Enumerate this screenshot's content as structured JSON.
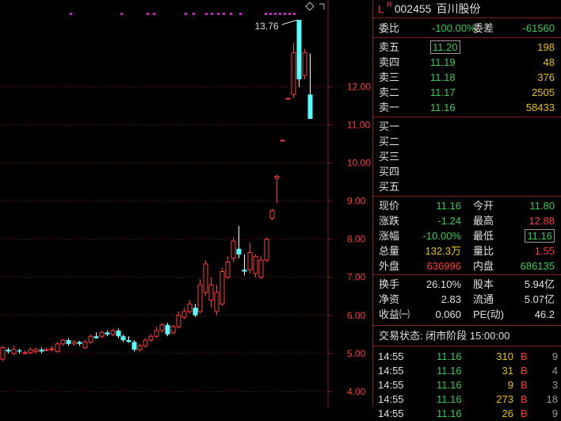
{
  "stock": {
    "flag_l": "L",
    "flag_r": "R",
    "code": "002455",
    "name": "百川股份"
  },
  "chart_data": {
    "type": "candlestick",
    "y_ticks": [
      "12.00",
      "11.00",
      "10.00",
      "9.00",
      "8.00",
      "7.00",
      "6.00",
      "5.00",
      "4.00"
    ],
    "high_annotation": "13.76",
    "ylim": [
      3.6,
      14.2
    ],
    "candles": [
      {
        "o": 4.85,
        "c": 5.15,
        "h": 5.2,
        "l": 4.8
      },
      {
        "o": 5.1,
        "c": 5.05,
        "h": 5.15,
        "l": 5.0
      },
      {
        "o": 5.0,
        "c": 5.1,
        "h": 5.2,
        "l": 4.95
      },
      {
        "o": 5.08,
        "c": 5.05,
        "h": 5.12,
        "l": 5.0
      },
      {
        "o": 5.0,
        "c": 5.02,
        "h": 5.08,
        "l": 4.98
      },
      {
        "o": 5.02,
        "c": 5.1,
        "h": 5.15,
        "l": 4.98
      },
      {
        "o": 5.05,
        "c": 5.1,
        "h": 5.15,
        "l": 5.0
      },
      {
        "o": 5.1,
        "c": 5.05,
        "h": 5.15,
        "l": 5.0
      },
      {
        "o": 5.08,
        "c": 5.1,
        "h": 5.15,
        "l": 5.05
      },
      {
        "o": 5.1,
        "c": 5.12,
        "h": 5.2,
        "l": 5.05
      },
      {
        "o": 5.05,
        "c": 5.25,
        "h": 5.3,
        "l": 5.02
      },
      {
        "o": 5.25,
        "c": 5.35,
        "h": 5.38,
        "l": 5.2
      },
      {
        "o": 5.35,
        "c": 5.25,
        "h": 5.4,
        "l": 5.2
      },
      {
        "o": 5.25,
        "c": 5.3,
        "h": 5.35,
        "l": 5.2
      },
      {
        "o": 5.3,
        "c": 5.25,
        "h": 5.33,
        "l": 5.2
      },
      {
        "o": 5.15,
        "c": 5.3,
        "h": 5.35,
        "l": 5.12
      },
      {
        "o": 5.3,
        "c": 5.45,
        "h": 5.5,
        "l": 5.25
      },
      {
        "o": 5.45,
        "c": 5.4,
        "h": 5.55,
        "l": 5.38
      },
      {
        "o": 5.45,
        "c": 5.55,
        "h": 5.6,
        "l": 5.4
      },
      {
        "o": 5.55,
        "c": 5.5,
        "h": 5.6,
        "l": 5.45
      },
      {
        "o": 5.5,
        "c": 5.6,
        "h": 5.65,
        "l": 5.45
      },
      {
        "o": 5.6,
        "c": 5.45,
        "h": 5.65,
        "l": 5.4
      },
      {
        "o": 5.45,
        "c": 5.35,
        "h": 5.5,
        "l": 5.3
      },
      {
        "o": 5.35,
        "c": 5.3,
        "h": 5.45,
        "l": 5.28
      },
      {
        "o": 5.3,
        "c": 5.1,
        "h": 5.35,
        "l": 5.05
      },
      {
        "o": 5.1,
        "c": 5.2,
        "h": 5.25,
        "l": 5.05
      },
      {
        "o": 5.2,
        "c": 5.35,
        "h": 5.4,
        "l": 5.15
      },
      {
        "o": 5.35,
        "c": 5.45,
        "h": 5.5,
        "l": 5.3
      },
      {
        "o": 5.45,
        "c": 5.6,
        "h": 5.7,
        "l": 5.4
      },
      {
        "o": 5.6,
        "c": 5.75,
        "h": 5.8,
        "l": 5.55
      },
      {
        "o": 5.75,
        "c": 5.5,
        "h": 5.8,
        "l": 5.45
      },
      {
        "o": 5.55,
        "c": 5.7,
        "h": 5.75,
        "l": 5.5
      },
      {
        "o": 5.7,
        "c": 6.0,
        "h": 6.1,
        "l": 5.65
      },
      {
        "o": 5.95,
        "c": 6.1,
        "h": 6.2,
        "l": 5.9
      },
      {
        "o": 6.1,
        "c": 6.3,
        "h": 6.4,
        "l": 6.05
      },
      {
        "o": 6.2,
        "c": 6.0,
        "h": 6.3,
        "l": 5.95
      },
      {
        "o": 6.1,
        "c": 6.8,
        "h": 6.95,
        "l": 6.05
      },
      {
        "o": 6.6,
        "c": 7.35,
        "h": 7.45,
        "l": 6.5
      },
      {
        "o": 6.4,
        "c": 6.8,
        "h": 7.0,
        "l": 6.2
      },
      {
        "o": 6.1,
        "c": 6.6,
        "h": 6.8,
        "l": 6.0
      },
      {
        "o": 6.3,
        "c": 7.15,
        "h": 7.25,
        "l": 6.25
      },
      {
        "o": 7.0,
        "c": 7.4,
        "h": 7.55,
        "l": 6.95
      },
      {
        "o": 7.5,
        "c": 7.95,
        "h": 8.05,
        "l": 7.4
      },
      {
        "o": 7.75,
        "c": 7.6,
        "h": 8.35,
        "l": 7.5
      },
      {
        "o": 7.2,
        "c": 7.15,
        "h": 7.6,
        "l": 7.05
      },
      {
        "o": 7.2,
        "c": 7.65,
        "h": 7.9,
        "l": 7.1
      },
      {
        "o": 7.1,
        "c": 7.55,
        "h": 7.6,
        "l": 7.0
      },
      {
        "o": 7.0,
        "c": 7.45,
        "h": 7.55,
        "l": 6.95
      },
      {
        "o": 7.45,
        "c": 8.0,
        "h": 8.05,
        "l": 7.4
      },
      {
        "o": 8.55,
        "c": 8.75,
        "h": 8.8,
        "l": 8.5
      },
      {
        "o": 9.6,
        "c": 9.65,
        "h": 9.7,
        "l": 8.95
      },
      {
        "o": 10.6,
        "c": 10.6,
        "h": 10.6,
        "l": 10.6
      },
      {
        "o": 11.7,
        "c": 11.7,
        "h": 11.7,
        "l": 11.7
      },
      {
        "o": 11.8,
        "c": 12.9,
        "h": 13.15,
        "l": 11.7
      },
      {
        "o": 13.76,
        "c": 12.2,
        "h": 13.76,
        "l": 12.0
      },
      {
        "o": 12.3,
        "c": 12.9,
        "h": 13.0,
        "l": 12.2
      },
      {
        "o": 11.8,
        "c": 11.16,
        "h": 12.88,
        "l": 11.16
      }
    ]
  },
  "panel": {
    "weibi_label": "委比",
    "weibi_value": "-100.00%",
    "weicha_label": "委差",
    "weicha_value": "-61560",
    "sell": [
      {
        "label": "卖五",
        "price": "11.20",
        "vol": "198"
      },
      {
        "label": "卖四",
        "price": "11.19",
        "vol": "48"
      },
      {
        "label": "卖三",
        "price": "11.18",
        "vol": "376"
      },
      {
        "label": "卖二",
        "price": "11.17",
        "vol": "2505"
      },
      {
        "label": "卖一",
        "price": "11.16",
        "vol": "58433"
      }
    ],
    "buy": [
      {
        "label": "买一"
      },
      {
        "label": "买二"
      },
      {
        "label": "买三"
      },
      {
        "label": "买四"
      },
      {
        "label": "买五"
      }
    ],
    "quote": [
      {
        "l1": "现价",
        "v1": "11.16",
        "c1": "g",
        "l2": "今开",
        "v2": "11.80",
        "c2": "g"
      },
      {
        "l1": "涨跌",
        "v1": "-1.24",
        "c1": "g",
        "l2": "最高",
        "v2": "12.88",
        "c2": "r"
      },
      {
        "l1": "涨幅",
        "v1": "-10.00%",
        "c1": "g",
        "l2": "最低",
        "v2": "11.16",
        "c2": "g"
      },
      {
        "l1": "总量",
        "v1": "132.3万",
        "c1": "y",
        "l2": "量比",
        "v2": "1.55",
        "c2": "r"
      },
      {
        "l1": "外盘",
        "v1": "636996",
        "c1": "r",
        "l2": "内盘",
        "v2": "686135",
        "c2": "g"
      }
    ],
    "fund": [
      {
        "l1": "换手",
        "v1": "26.10%",
        "l2": "股本",
        "v2": "5.94亿"
      },
      {
        "l1": "净资",
        "v1": "2.83",
        "l2": "流通",
        "v2": "5.07亿"
      },
      {
        "l1": "收益㈠",
        "v1": "0.060",
        "l2": "PE(动)",
        "v2": "46.2"
      }
    ],
    "status": "交易状态: 闭市阶段 15:00:00",
    "trades": [
      {
        "t": "14:55",
        "p": "11.16",
        "v": "310",
        "bs": "B",
        "n": "9"
      },
      {
        "t": "14:55",
        "p": "11.16",
        "v": "31",
        "bs": "B",
        "n": "4"
      },
      {
        "t": "14:55",
        "p": "11.16",
        "v": "9",
        "bs": "B",
        "n": "3"
      },
      {
        "t": "14:55",
        "p": "11.16",
        "v": "273",
        "bs": "B",
        "n": "18"
      },
      {
        "t": "14:55",
        "p": "11.16",
        "v": "26",
        "bs": "B",
        "n": "9"
      }
    ]
  }
}
